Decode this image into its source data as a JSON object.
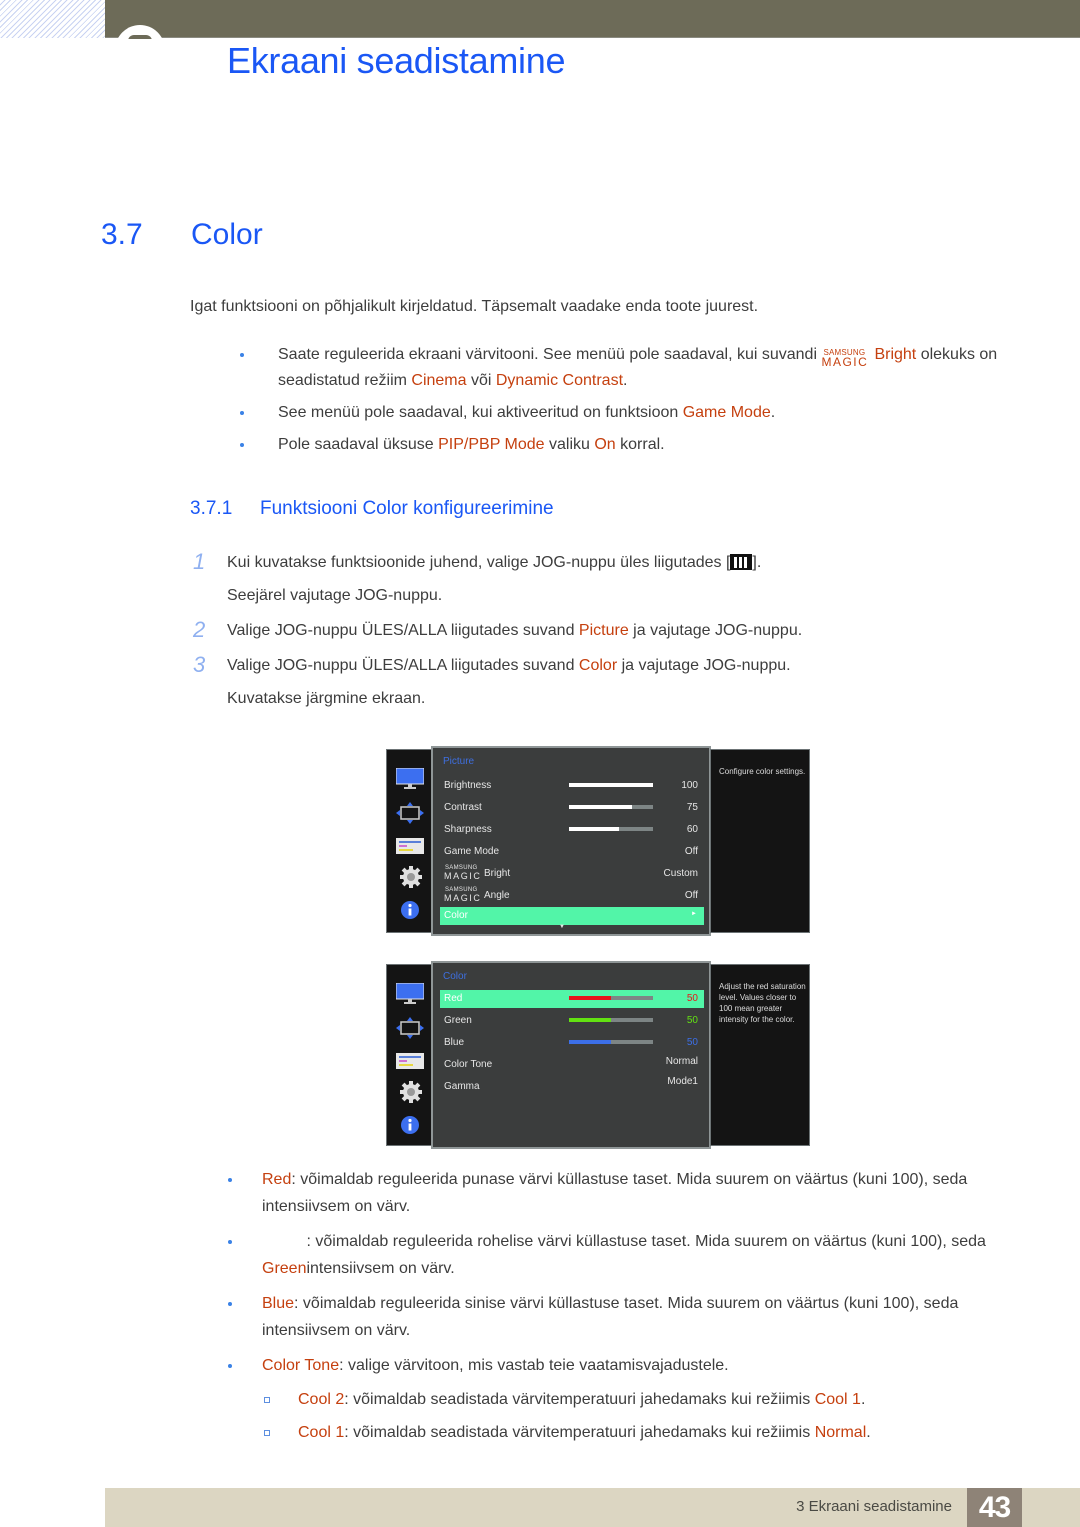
{
  "header": {
    "chapter_title": "Ekraani seadistamine"
  },
  "section": {
    "number": "3.7",
    "title": "Color",
    "intro": "Igat funktsiooni on põhjalikult kirjeldatud. Täpsemalt vaadake enda toote juurest.",
    "notes": [
      {
        "t1": "Saate reguleerida ekraani värvitooni. See menüü pole saadaval, kui suvandi ",
        "magic_top": "SAMSUNG",
        "magic_bottom": "MAGIC",
        "hl1": "Bright",
        "t2": " olekuks on seadistatud režiim ",
        "hl2": "Cinema",
        "t3": " või ",
        "hl3": "Dynamic Contrast",
        "t4": "."
      },
      {
        "t1": "See menüü pole saadaval, kui aktiveeritud on funktsioon ",
        "hl1": "Game Mode",
        "t2": "."
      },
      {
        "t1": "Pole saadaval üksuse ",
        "hl1": "PIP/PBP Mode",
        "t2": " valiku ",
        "hl2": "On",
        "t3": " korral."
      }
    ]
  },
  "subsection": {
    "number": "3.7.1",
    "title": "Funktsiooni Color konfigureerimine",
    "steps": [
      {
        "num": "1",
        "t1": "Kui kuvatakse funktsioonide juhend, valige JOG-nuppu üles liigutades [",
        "t2": "].",
        "line2": "Seejärel vajutage JOG-nuppu."
      },
      {
        "num": "2",
        "t1": "Valige JOG-nuppu ÜLES/ALLA liigutades suvand ",
        "hl": "Picture",
        "t2": " ja vajutage JOG-nuppu."
      },
      {
        "num": "3",
        "t1": "Valige JOG-nuppu ÜLES/ALLA liigutades suvand ",
        "hl": "Color",
        "t2": " ja vajutage JOG-nuppu.",
        "line2": "Kuvatakse järgmine ekraan."
      }
    ]
  },
  "osd_picture": {
    "title": "Picture",
    "rows": [
      {
        "label": "Brightness",
        "value": "100",
        "level": 100
      },
      {
        "label": "Contrast",
        "value": "75",
        "level": 75
      },
      {
        "label": "Sharpness",
        "value": "60",
        "level": 60
      },
      {
        "label": "Game Mode",
        "value": "Off"
      },
      {
        "magic_top": "SAMSUNG",
        "magic_bottom": "MAGIC",
        "label": "Bright",
        "value": "Custom"
      },
      {
        "magic_top": "SAMSUNG",
        "magic_bottom": "MAGIC",
        "label": "Angle",
        "value": "Off"
      },
      {
        "label": "Color",
        "arrow": "►",
        "selected": true
      }
    ],
    "more_indicator": "▼",
    "help": "Configure color settings."
  },
  "osd_color": {
    "title": "Color",
    "rows": [
      {
        "label": "Red",
        "value": "50",
        "level": 50,
        "color": "#e8141a",
        "selected": true
      },
      {
        "label": "Green",
        "value": "50",
        "level": 50,
        "color": "#62e212"
      },
      {
        "label": "Blue",
        "value": "50",
        "level": 50,
        "color": "#3c6fe8"
      },
      {
        "label": "Color Tone",
        "value": "Normal"
      },
      {
        "label": "Gamma",
        "value": "Mode1"
      }
    ],
    "help": "Adjust the red saturation level. Values closer to 100 mean greater intensity for the color."
  },
  "osd_sidebar_icons": [
    "monitor-icon",
    "size-position-icon",
    "pip-pbp-icon",
    "system-gear-icon",
    "info-icon"
  ],
  "descriptions": [
    {
      "term": "Red",
      "text": ": võimaldab reguleerida punase värvi küllastuse taset. Mida suurem on väärtus (kuni 100), seda intensiivsem on värv."
    },
    {
      "term": "Green",
      "text": ": võimaldab reguleerida rohelise värvi küllastuse taset. Mida suurem on väärtus (kuni 100), seda intensiivsem on värv."
    },
    {
      "term": "Blue",
      "text": ": võimaldab reguleerida sinise värvi küllastuse taset. Mida suurem on väärtus (kuni 100), seda intensiivsem on värv."
    },
    {
      "term": "Color Tone",
      "text": ": valige värvitoon, mis vastab teie vaatamisvajadustele."
    }
  ],
  "color_tone_options": [
    {
      "term": "Cool 2",
      "text": ": võimaldab seadistada värvitemperatuuri jahedamaks kui režiimis ",
      "ref": "Cool 1",
      "end": "."
    },
    {
      "term": "Cool 1",
      "text": ": võimaldab seadistada värvitemperatuuri jahedamaks kui režiimis ",
      "ref": "Normal",
      "end": "."
    }
  ],
  "footer": {
    "chapter": "3 Ekraani seadistamine",
    "page": "43"
  },
  "colors": {
    "heading_blue": "#1a57f5",
    "highlight_orange": "#c5400f",
    "header_band": "#6d6b58",
    "footer_band": "#dcd6c2",
    "osd_selection": "#52f5a8"
  }
}
